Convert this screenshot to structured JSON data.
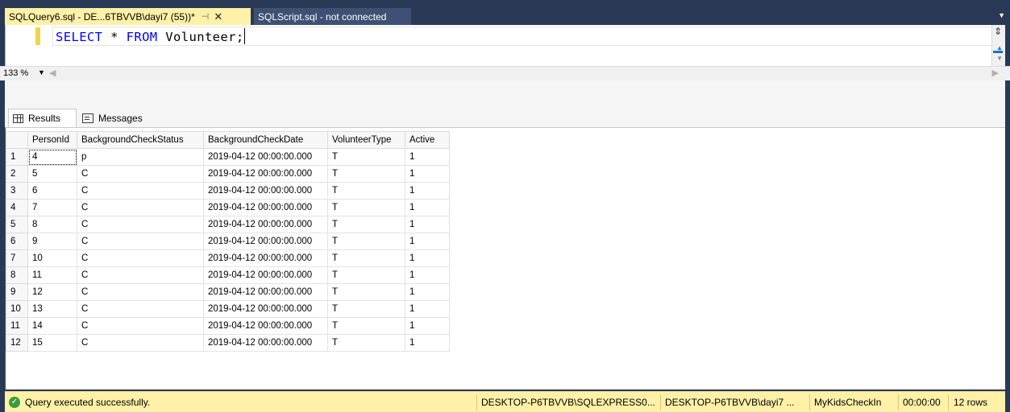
{
  "tabs": [
    {
      "label": "SQLQuery6.sql - DE...6TBVVB\\dayi7 (55))*",
      "pin": "⊣",
      "close": "✕"
    },
    {
      "label": "SQLScript.sql - not connected"
    }
  ],
  "editor": {
    "keyword_select": "SELECT",
    "star": " * ",
    "keyword_from": "FROM",
    "table_name": " Volunteer;"
  },
  "zoom": {
    "value": "133 %"
  },
  "result_tabs": {
    "results_label": "Results",
    "messages_label": "Messages"
  },
  "grid": {
    "columns": [
      "",
      "PersonId",
      "BackgroundCheckStatus",
      "BackgroundCheckDate",
      "VolunteerType",
      "Active"
    ],
    "rows": [
      [
        "1",
        "4",
        "p",
        "2019-04-12 00:00:00.000",
        "T",
        "1"
      ],
      [
        "2",
        "5",
        "C",
        "2019-04-12 00:00:00.000",
        "T",
        "1"
      ],
      [
        "3",
        "6",
        "C",
        "2019-04-12 00:00:00.000",
        "T",
        "1"
      ],
      [
        "4",
        "7",
        "C",
        "2019-04-12 00:00:00.000",
        "T",
        "1"
      ],
      [
        "5",
        "8",
        "C",
        "2019-04-12 00:00:00.000",
        "T",
        "1"
      ],
      [
        "6",
        "9",
        "C",
        "2019-04-12 00:00:00.000",
        "T",
        "1"
      ],
      [
        "7",
        "10",
        "C",
        "2019-04-12 00:00:00.000",
        "T",
        "1"
      ],
      [
        "8",
        "11",
        "C",
        "2019-04-12 00:00:00.000",
        "T",
        "1"
      ],
      [
        "9",
        "12",
        "C",
        "2019-04-12 00:00:00.000",
        "T",
        "1"
      ],
      [
        "10",
        "13",
        "C",
        "2019-04-12 00:00:00.000",
        "T",
        "1"
      ],
      [
        "11",
        "14",
        "C",
        "2019-04-12 00:00:00.000",
        "T",
        "1"
      ],
      [
        "12",
        "15",
        "C",
        "2019-04-12 00:00:00.000",
        "T",
        "1"
      ]
    ]
  },
  "status": {
    "message": "Query executed successfully.",
    "server": "DESKTOP-P6TBVVB\\SQLEXPRESS0...",
    "user": "DESKTOP-P6TBVVB\\dayi7 ...",
    "database": "MyKidsCheckIn",
    "elapsed": "00:00:00",
    "rows": "12 rows"
  },
  "colors": {
    "tab_active": "#fff1a8",
    "chrome": "#293955",
    "keyword": "#0000ff",
    "status_bar": "#fff1a8",
    "success": "#389e3c"
  }
}
